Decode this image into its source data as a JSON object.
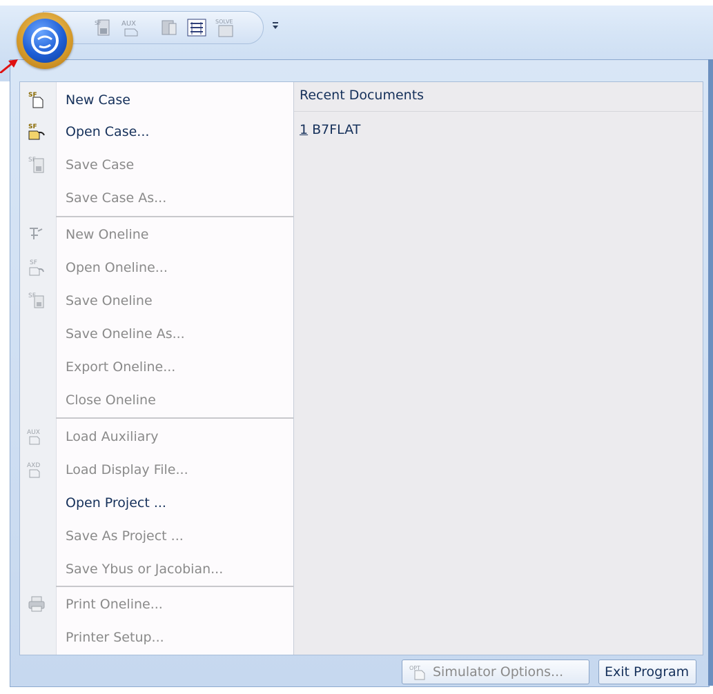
{
  "quick_access": {
    "icons": [
      "save-case-icon",
      "load-auxiliary-icon",
      "save-icon",
      "oneline-icon",
      "solve-icon"
    ],
    "dropdown_icon": "customize-dropdown-icon"
  },
  "orb": {
    "icon": "globe-orb-icon"
  },
  "menu": {
    "items": [
      {
        "label": "New Case",
        "icon": "new-case-icon",
        "enabled": true
      },
      {
        "label": "Open Case...",
        "icon": "open-case-icon",
        "enabled": true
      },
      {
        "label": "Save Case",
        "icon": "save-case-icon",
        "enabled": false
      },
      {
        "label": "Save Case As...",
        "icon": "",
        "enabled": false
      },
      {
        "label": "New Oneline",
        "icon": "new-oneline-icon",
        "enabled": false
      },
      {
        "label": "Open Oneline...",
        "icon": "open-oneline-icon",
        "enabled": false
      },
      {
        "label": "Save Oneline",
        "icon": "save-oneline-icon",
        "enabled": false
      },
      {
        "label": "Save Oneline As...",
        "icon": "",
        "enabled": false
      },
      {
        "label": "Export Oneline...",
        "icon": "",
        "enabled": false
      },
      {
        "label": "Close Oneline",
        "icon": "",
        "enabled": false
      },
      {
        "label": "Load Auxiliary",
        "icon": "load-auxiliary-icon",
        "enabled": false
      },
      {
        "label": "Load Display File...",
        "icon": "load-display-icon",
        "enabled": false
      },
      {
        "label": "Open Project ...",
        "icon": "",
        "enabled": true
      },
      {
        "label": "Save As Project ...",
        "icon": "",
        "enabled": false
      },
      {
        "label": "Save Ybus or Jacobian...",
        "icon": "",
        "enabled": false
      },
      {
        "label": "Print Oneline...",
        "icon": "printer-icon",
        "enabled": false
      },
      {
        "label": "Printer Setup...",
        "icon": "",
        "enabled": false
      }
    ]
  },
  "recent": {
    "header": "Recent Documents",
    "items": [
      {
        "index": "1",
        "name": " B7FLAT"
      }
    ]
  },
  "buttons": {
    "simulator_options": "Simulator Options...",
    "simulator_options_icon": "options-icon",
    "exit_program": "Exit Program"
  }
}
